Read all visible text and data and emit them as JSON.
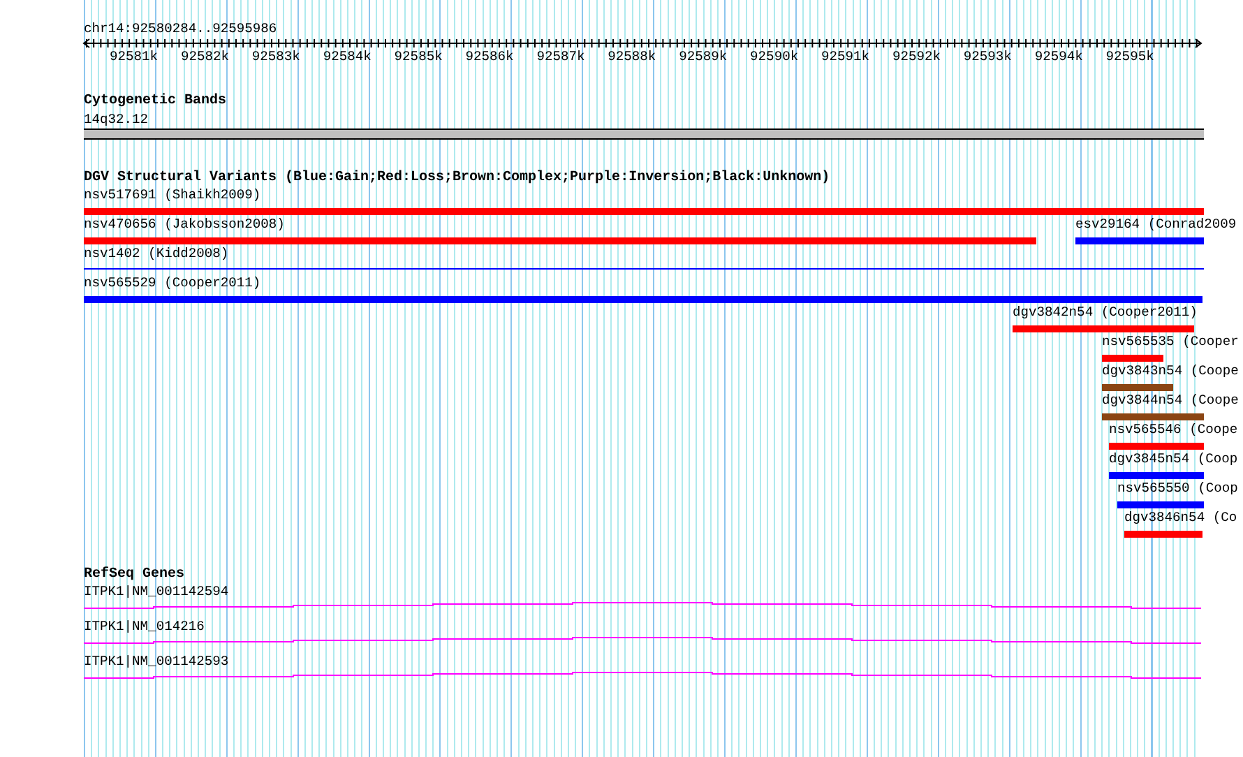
{
  "ruler": {
    "range": "chr14:92580284..92595986",
    "ticks": [
      "92581k",
      "92582k",
      "92583k",
      "92584k",
      "92585k",
      "92586k",
      "92587k",
      "92588k",
      "92589k",
      "92590k",
      "92591k",
      "92592k",
      "92593k",
      "92594k",
      "92595k"
    ]
  },
  "cytogenetic_bands": {
    "title": "Cytogenetic Bands",
    "band": "14q32.12"
  },
  "dgv": {
    "title": "DGV Structural Variants (Blue:Gain;Red:Loss;Brown:Complex;Purple:Inversion;Black:Unknown)",
    "variants": [
      {
        "label": "nsv517691 (Shaikh2009)",
        "color": "#ff0000",
        "kind": "bar"
      },
      {
        "label": "nsv470656 (Jakobsson2008)",
        "color": "#ff0000",
        "kind": "bar"
      },
      {
        "label": "esv29164 (Conrad2009",
        "color": "#0000ff",
        "kind": "bar"
      },
      {
        "label": "nsv1402 (Kidd2008)",
        "color": "#0000ff",
        "kind": "line"
      },
      {
        "label": "nsv565529 (Cooper2011)",
        "color": "#0000ff",
        "kind": "bar"
      },
      {
        "label": "dgv3842n54 (Cooper2011)",
        "color": "#ff0000",
        "kind": "bar"
      },
      {
        "label": "nsv565535 (Cooper",
        "color": "#ff0000",
        "kind": "bar"
      },
      {
        "label": "dgv3843n54 (Coope",
        "color": "#8b4513",
        "kind": "bar"
      },
      {
        "label": "dgv3844n54 (Coope",
        "color": "#8b4513",
        "kind": "bar"
      },
      {
        "label": "nsv565546 (Coope",
        "color": "#ff0000",
        "kind": "bar"
      },
      {
        "label": "dgv3845n54 (Coop",
        "color": "#0000ff",
        "kind": "bar"
      },
      {
        "label": "nsv565550 (Coop",
        "color": "#0000ff",
        "kind": "bar"
      },
      {
        "label": "dgv3846n54 (Co",
        "color": "#ff0000",
        "kind": "bar"
      }
    ]
  },
  "refseq": {
    "title": "RefSeq Genes",
    "genes": [
      {
        "label": "ITPK1|NM_001142594"
      },
      {
        "label": "ITPK1|NM_014216"
      },
      {
        "label": "ITPK1|NM_001142593"
      }
    ]
  }
}
